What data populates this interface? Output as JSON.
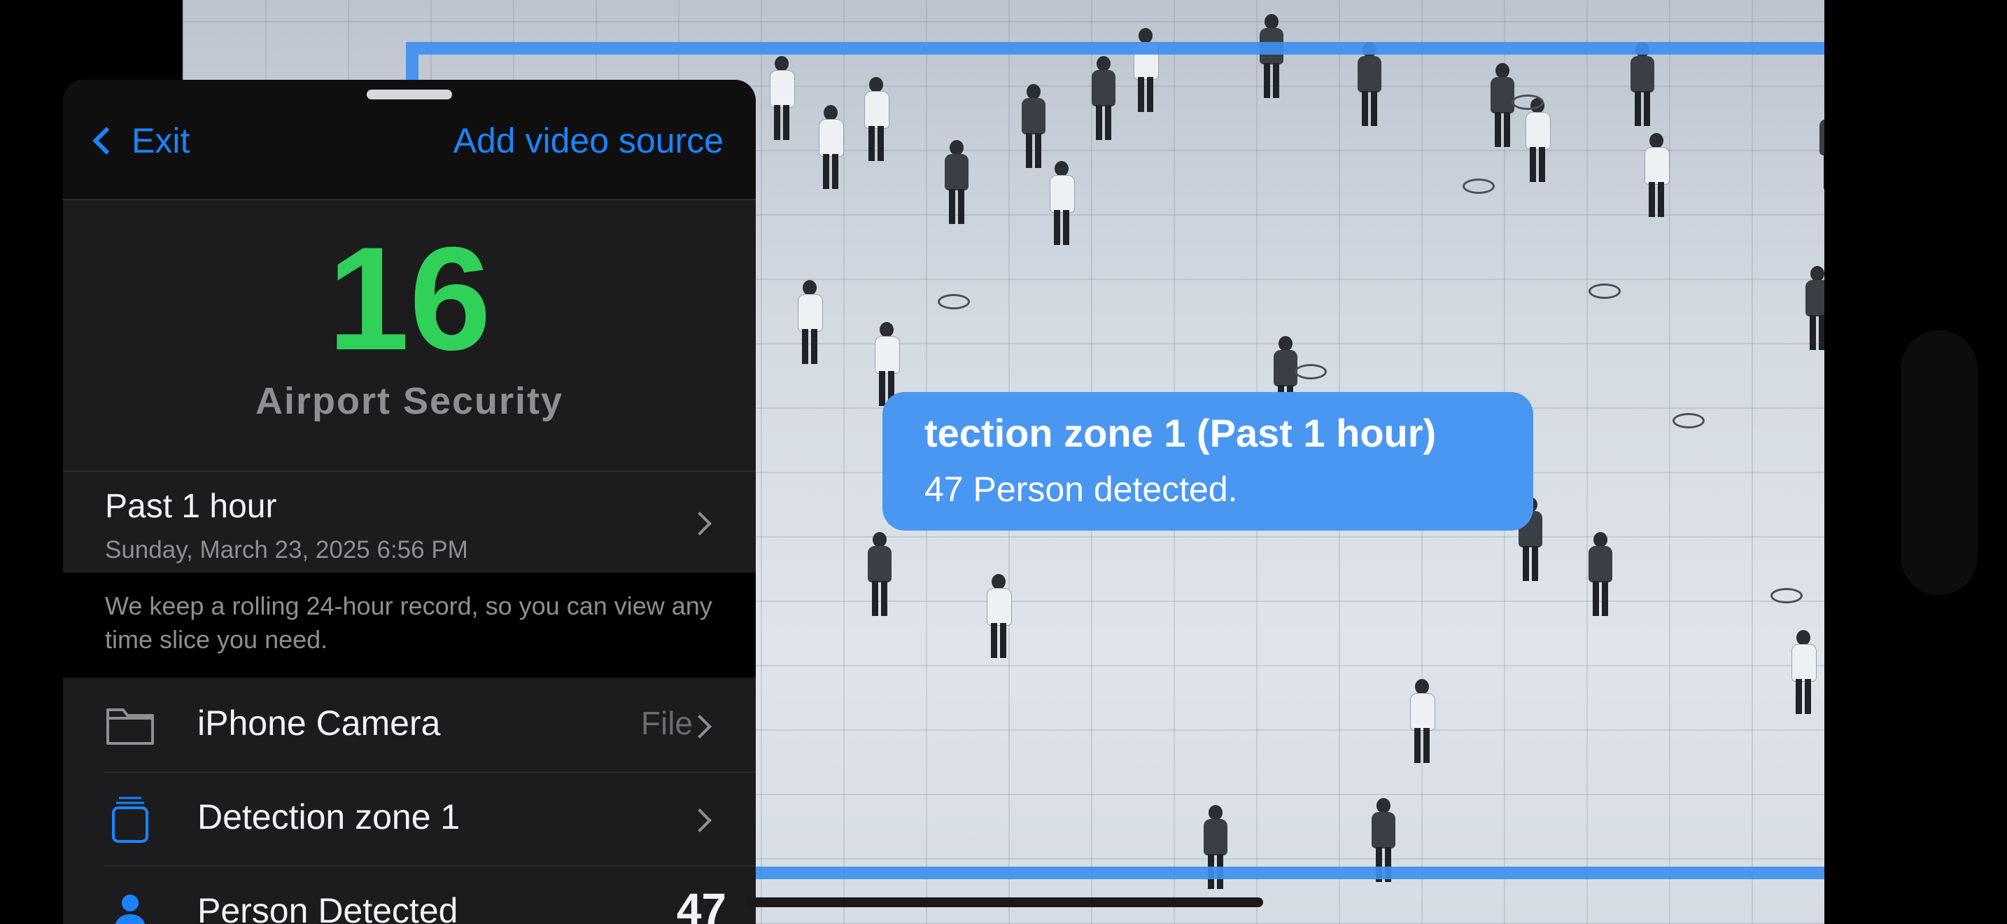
{
  "app": {
    "nav": {
      "exit_label": "Exit",
      "add_source_label": "Add video source"
    },
    "summary": {
      "count": "16",
      "label": "Airport Security"
    },
    "time_range": {
      "title": "Past 1 hour",
      "timestamp": "Sunday, March 23, 2025 6:56 PM"
    },
    "info_text": "We keep a rolling 24-hour record, so you can view any time slice you need.",
    "rows": [
      {
        "icon": "folder-icon",
        "label": "iPhone Camera",
        "value": "File"
      },
      {
        "icon": "detection-zone-icon",
        "label": "Detection zone 1",
        "value": ""
      },
      {
        "icon": "person-icon",
        "label": "Person Detected",
        "value": "47"
      }
    ]
  },
  "feed": {
    "zone_callout": {
      "title": "tection zone 1 (Past 1 hour)",
      "subtitle": "47 Person detected."
    }
  },
  "colors": {
    "accent": "#1a84ff",
    "count_green": "#30d158",
    "zone_blue": "#3f8ff0"
  }
}
